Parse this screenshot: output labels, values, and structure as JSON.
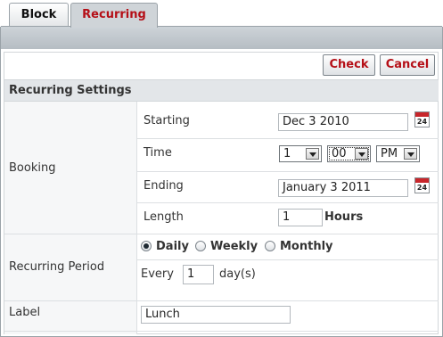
{
  "tabs": [
    {
      "label": "Block",
      "active": false
    },
    {
      "label": "Recurring",
      "active": true
    }
  ],
  "toolbar": {
    "check_label": "Check",
    "cancel_label": "Cancel"
  },
  "section_title": "Recurring Settings",
  "booking": {
    "label": "Booking",
    "starting_label": "Starting",
    "starting_value": "Dec 3 2010",
    "time_label": "Time",
    "time_hour": "1",
    "time_minute": "00",
    "time_ampm": "PM",
    "ending_label": "Ending",
    "ending_value": "January 3 2011",
    "length_label": "Length",
    "length_value": "1",
    "length_unit": "Hours",
    "calendar_number": "24"
  },
  "recurring": {
    "label": "Recurring Period",
    "options": [
      "Daily",
      "Weekly",
      "Monthly"
    ],
    "selected": "Daily",
    "every_label": "Every",
    "every_value": "1",
    "every_unit": "day(s)"
  },
  "label_row": {
    "label": "Label",
    "value": "Lunch"
  },
  "colors": {
    "accent_red": "#b50f17",
    "header_bar": "#b6bdc3"
  },
  "icons": {
    "calendar": "calendar-icon",
    "dropdown": "chevron-down-icon"
  }
}
